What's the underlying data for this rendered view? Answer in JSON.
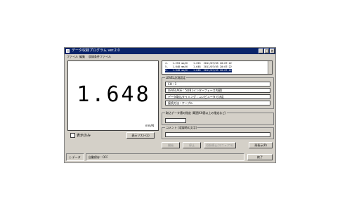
{
  "window": {
    "title": "データ収録プログラム ver.2.0",
    "controls": [
      "_",
      "□",
      "×"
    ]
  },
  "menu": [
    "ファイル",
    "編集",
    "収録条件ファイル"
  ],
  "display": {
    "value": "1.648",
    "unit": "mm/N"
  },
  "display_only": {
    "label": "表示のみ",
    "checked": false
  },
  "buttons": {
    "show_list": "表示リスト(L)",
    "b1": "開始",
    "b2": "停止",
    "b3": "収録停止(マニュアル)",
    "b4": "再表示(P)",
    "exit": "終了"
  },
  "log": {
    "rows": [
      "4.   1.253 mm/N    1.253  2011/07/05 20:07:22",
      "5.   1.648 mm/N    1.648  2011/07/05 20:07:22",
      "6.   1.648 mm/N    1.648  2011/07/05 20:07:22"
    ],
    "selected_index": 2
  },
  "level_settings": {
    "label": "LEVEL計測設定",
    "fields": [
      "CH : 1",
      "LEVELAGE : 5LIB (インターフェース内蔵)",
      "データ取込タイミング : コンピュータで決定",
      "接続方法 : ケーブル"
    ]
  },
  "range": {
    "label": "取込データ値の指定 (範囲XX値以上の指定など)",
    "value": ""
  },
  "comment": {
    "label": "コメント (収録時の文字)",
    "value": ""
  },
  "status": {
    "mode": "データ",
    "auto": "自動保存 : OFF"
  }
}
